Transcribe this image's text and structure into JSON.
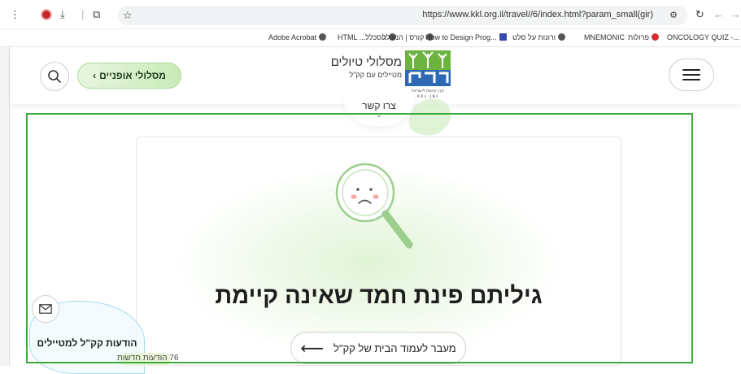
{
  "browser": {
    "url": "https://www.kkl.org.il/travel//6/index.html?param_small(gir)",
    "bookmarks": [
      "Adobe Acrobat",
      "HTML ...הסכלל",
      "קורס | המכלל",
      "How to Design Prog...",
      "ורונות על סלט",
      "MNEMONIC",
      "פרולות",
      "ONCOLOGY QUIZ -..."
    ]
  },
  "header": {
    "bike_routes_label": "מסלולי אופניים",
    "bike_routes_chevron": "›",
    "brand_title": "מסלולי טיולים",
    "brand_subtitle": "מטיילים עם קק\"ל",
    "logo_caption": "קרן קיימת לישראל",
    "logo_latin": "K K L · J N F"
  },
  "contact": {
    "label": "צרו קשר",
    "chevron": "⌄"
  },
  "main": {
    "headline": "גיליתם פינת חמד שאינה קיימת",
    "home_button_label": "מעבר לעמוד הבית של קק\"ל",
    "home_button_arrow": "⟵"
  },
  "newsletter": {
    "title": "הודעות קק\"ל למטיילים",
    "count_text": "76 הודעות חדשות"
  },
  "colors": {
    "frame": "#3daa3d",
    "bike_button": "#c9ebb8",
    "logo_green": "#6db33f",
    "logo_blue": "#2e6ab3"
  }
}
